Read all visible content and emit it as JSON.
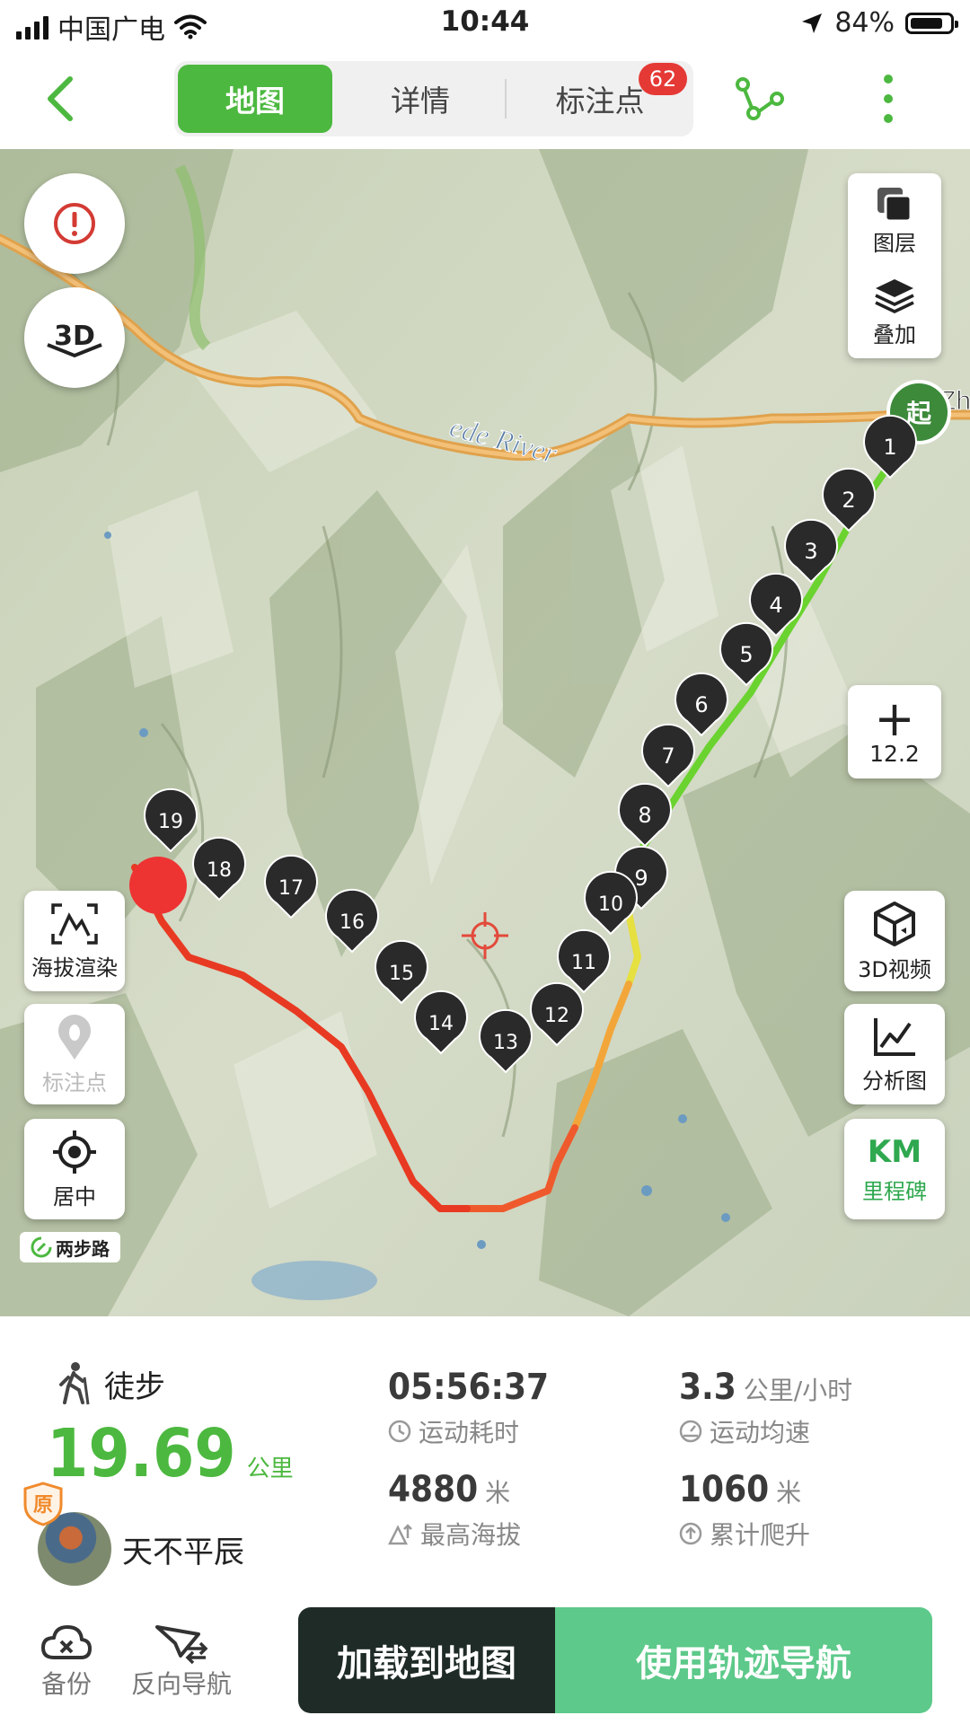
{
  "status_bar": {
    "carrier": "中国广电",
    "time": "10:44",
    "battery_pct": "84%",
    "battery_level": 0.84
  },
  "nav": {
    "tabs": [
      {
        "label": "地图",
        "active": true
      },
      {
        "label": "详情",
        "active": false
      },
      {
        "label": "标注点",
        "active": false
      }
    ],
    "badge_count": "62",
    "icons": [
      "back-arrow-icon",
      "route-branch-icon",
      "more-vertical-icon"
    ]
  },
  "map": {
    "river_label": "ede River",
    "edge_label": "Zh",
    "start_marker": "起",
    "left_tools": {
      "alert_icon": "alert-icon",
      "three_d": "3D",
      "elevation_render": "海拔渲染",
      "waypoints": "标注点",
      "center": "居中"
    },
    "layers": {
      "layer": "图层",
      "overlay": "叠加"
    },
    "zoom": {
      "plus": "+",
      "level": "12.2"
    },
    "right_tools": {
      "video_3d": "3D视频",
      "analysis": "分析图",
      "km_title": "KM",
      "milestone": "里程碑"
    },
    "brand": "两步路",
    "waypoint_labels": [
      "1",
      "2",
      "3",
      "4",
      "5",
      "6",
      "7",
      "8",
      "9",
      "10",
      "11",
      "12",
      "13",
      "14",
      "15",
      "16",
      "17",
      "18",
      "19"
    ]
  },
  "stats": {
    "activity": "徒步",
    "distance": "19.69",
    "distance_unit": "公里",
    "user_name": "天不平辰",
    "original_badge": "原",
    "duration": {
      "value": "05:56:37",
      "caption": "运动耗时"
    },
    "avg_speed": {
      "value": "3.3",
      "unit": "公里/小时",
      "caption": "运动均速"
    },
    "max_altitude": {
      "value": "4880",
      "unit": "米",
      "caption": "最高海拔"
    },
    "total_climb": {
      "value": "1060",
      "unit": "米",
      "caption": "累计爬升"
    }
  },
  "bottom": {
    "backup": "备份",
    "reverse_nav": "反向导航",
    "load_to_map": "加载到地图",
    "track_nav": "使用轨迹导航"
  },
  "colors": {
    "brand_green": "#4cb83f",
    "button_dark": "#1f2b26",
    "button_green": "#5dc98a",
    "badge_red": "#e53935"
  }
}
